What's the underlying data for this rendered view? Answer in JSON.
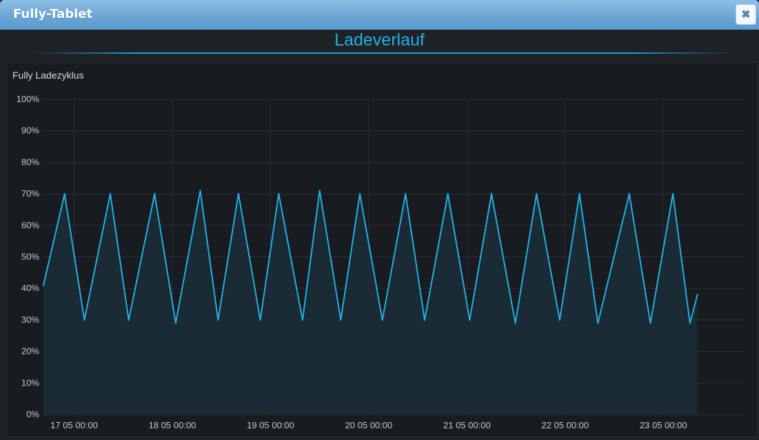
{
  "window": {
    "title": "Fully-Tablet",
    "close_icon": "close-icon"
  },
  "section": {
    "heading": "Ladeverlauf"
  },
  "panel": {
    "title": "Fully Ladezyklus"
  },
  "colors": {
    "line": "#1fb1e6",
    "fill": "#1b2e3a",
    "grid": "#2a3038",
    "text": "#c7c9cc"
  },
  "chart_data": {
    "type": "area",
    "title": "Fully Ladezyklus",
    "xlabel": "",
    "ylabel": "",
    "ylim": [
      0,
      100
    ],
    "ytick_labels": [
      "0%",
      "10%",
      "20%",
      "30%",
      "40%",
      "50%",
      "60%",
      "70%",
      "80%",
      "90%",
      "100%"
    ],
    "xlim_hours": [
      -7.5,
      164
    ],
    "xtick_labels": [
      "17 05 00:00",
      "18 05 00:00",
      "19 05 00:00",
      "20 05 00:00",
      "21 05 00:00",
      "22 05 00:00",
      "23 05 00:00"
    ],
    "series": [
      {
        "points": [
          {
            "x": "16 05 16:30",
            "y": 41
          },
          {
            "x": "16 05 21:40",
            "y": 70
          },
          {
            "x": "17 05 02:30",
            "y": 30
          },
          {
            "x": "17 05 08:50",
            "y": 70
          },
          {
            "x": "17 05 13:20",
            "y": 30
          },
          {
            "x": "17 05 19:40",
            "y": 70
          },
          {
            "x": "18 05 00:50",
            "y": 29
          },
          {
            "x": "18 05 06:50",
            "y": 71
          },
          {
            "x": "18 05 11:10",
            "y": 30
          },
          {
            "x": "18 05 16:10",
            "y": 70
          },
          {
            "x": "18 05 21:30",
            "y": 30
          },
          {
            "x": "19 05 02:00",
            "y": 70
          },
          {
            "x": "19 05 07:50",
            "y": 30
          },
          {
            "x": "19 05 12:00",
            "y": 71
          },
          {
            "x": "19 05 17:10",
            "y": 30
          },
          {
            "x": "19 05 21:50",
            "y": 70
          },
          {
            "x": "20 05 03:20",
            "y": 30
          },
          {
            "x": "20 05 09:00",
            "y": 70
          },
          {
            "x": "20 05 13:40",
            "y": 30
          },
          {
            "x": "20 05 19:20",
            "y": 70
          },
          {
            "x": "21 05 00:40",
            "y": 30
          },
          {
            "x": "21 05 06:00",
            "y": 70
          },
          {
            "x": "21 05 11:50",
            "y": 29
          },
          {
            "x": "21 05 17:00",
            "y": 70
          },
          {
            "x": "21 05 22:40",
            "y": 30
          },
          {
            "x": "22 05 03:30",
            "y": 70
          },
          {
            "x": "22 05 08:00",
            "y": 29
          },
          {
            "x": "22 05 15:40",
            "y": 70
          },
          {
            "x": "22 05 20:50",
            "y": 29
          },
          {
            "x": "23 05 02:20",
            "y": 70
          },
          {
            "x": "23 05 06:30",
            "y": 29
          },
          {
            "x": "23 05 08:20",
            "y": 38
          }
        ]
      }
    ],
    "grid": true,
    "legend": "none"
  }
}
